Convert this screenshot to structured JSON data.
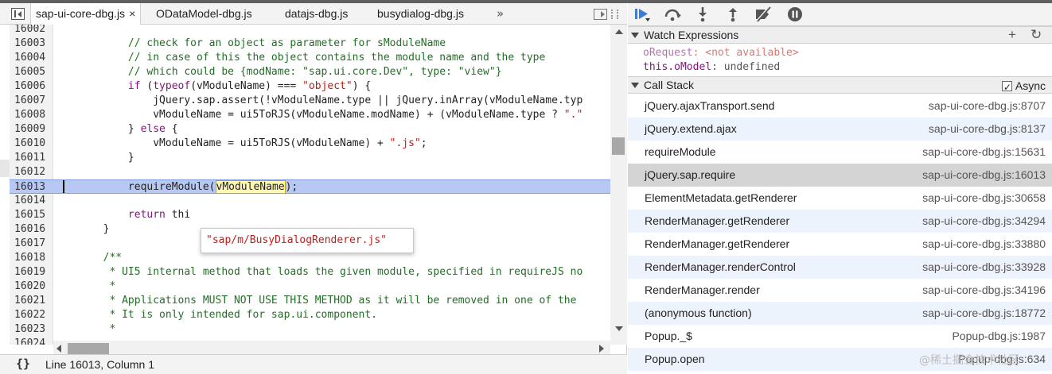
{
  "tabs": [
    {
      "label": "sap-ui-core-dbg.js",
      "active": true,
      "close": "×"
    },
    {
      "label": "ODataModel-dbg.js",
      "active": false
    },
    {
      "label": "datajs-dbg.js",
      "active": false
    },
    {
      "label": "busydialog-dbg.js",
      "active": false
    }
  ],
  "tab_overflow": "»",
  "code_lines": [
    {
      "num": "16002",
      "text": ""
    },
    {
      "num": "16003",
      "text": "            // check for an object as parameter for sModuleName"
    },
    {
      "num": "16004",
      "text": "            // in case of this the object contains the module name and the type"
    },
    {
      "num": "16005",
      "text": "            // which could be {modName: \"sap.ui.core.Dev\", type: \"view\"}"
    },
    {
      "num": "16006",
      "text": "            if (typeof(vModuleName) === \"object\") {"
    },
    {
      "num": "16007",
      "text": "                jQuery.sap.assert(!vModuleName.type || jQuery.inArray(vModuleName.typ"
    },
    {
      "num": "16008",
      "text": "                vModuleName = ui5ToRJS(vModuleName.modName) + (vModuleName.type ? \".\""
    },
    {
      "num": "16009",
      "text": "            } else {"
    },
    {
      "num": "16010",
      "text": "                vModuleName = ui5ToRJS(vModuleName) + \".js\";"
    },
    {
      "num": "16011",
      "text": "            }"
    },
    {
      "num": "16012",
      "text": ""
    },
    {
      "num": "16013",
      "text": "            requireModule(vModuleName);"
    },
    {
      "num": "16014",
      "text": ""
    },
    {
      "num": "16015",
      "text": "            return thi"
    },
    {
      "num": "16016",
      "text": "        }"
    },
    {
      "num": "16017",
      "text": ""
    },
    {
      "num": "16018",
      "text": "        /**"
    },
    {
      "num": "16019",
      "text": "         * UI5 internal method that loads the given module, specified in requireJS no"
    },
    {
      "num": "16020",
      "text": "         *"
    },
    {
      "num": "16021",
      "text": "         * Applications MUST NOT USE THIS METHOD as it will be removed in one of the"
    },
    {
      "num": "16022",
      "text": "         * It is only intended for sap.ui.component."
    },
    {
      "num": "16023",
      "text": "         *"
    },
    {
      "num": "16024",
      "text": ""
    }
  ],
  "popover": {
    "value": "\"sap/m/BusyDialogRenderer.js\""
  },
  "status": {
    "pretty_print": "{}",
    "position": "Line 16013, Column 1"
  },
  "watch": {
    "title": "Watch Expressions",
    "add": "+",
    "refresh": "↻",
    "items": [
      {
        "name": "oRequest",
        "sep": ": ",
        "value": "<not available>",
        "available": false
      },
      {
        "name": "this.oModel",
        "sep": ": ",
        "value": "undefined",
        "available": true
      }
    ]
  },
  "call_stack": {
    "title": "Call Stack",
    "async_label": "Async",
    "async_checked": true,
    "frames": [
      {
        "fn": "jQuery.ajaxTransport.send",
        "loc": "sap-ui-core-dbg.js:8707"
      },
      {
        "fn": "jQuery.extend.ajax",
        "loc": "sap-ui-core-dbg.js:8137"
      },
      {
        "fn": "requireModule",
        "loc": "sap-ui-core-dbg.js:15631"
      },
      {
        "fn": "jQuery.sap.require",
        "loc": "sap-ui-core-dbg.js:16013",
        "selected": true
      },
      {
        "fn": "ElementMetadata.getRenderer",
        "loc": "sap-ui-core-dbg.js:30658"
      },
      {
        "fn": "RenderManager.getRenderer",
        "loc": "sap-ui-core-dbg.js:34294"
      },
      {
        "fn": "RenderManager.getRenderer",
        "loc": "sap-ui-core-dbg.js:33880"
      },
      {
        "fn": "RenderManager.renderControl",
        "loc": "sap-ui-core-dbg.js:33928"
      },
      {
        "fn": "RenderManager.render",
        "loc": "sap-ui-core-dbg.js:34196"
      },
      {
        "fn": "(anonymous function)",
        "loc": "sap-ui-core-dbg.js:18772"
      },
      {
        "fn": "Popup._$",
        "loc": "Popup-dbg.js:1987"
      },
      {
        "fn": "Popup.open",
        "loc": "Popup-dbg.js:634"
      }
    ]
  },
  "watermark": "@稀土掘金技术社区",
  "colors": {
    "exec_line": "#b7c9f3",
    "selected_frame": "#d4d4d4",
    "alt_row": "#edf3fd",
    "comment": "#236e25",
    "keyword": "#881280",
    "string": "#c41a16",
    "resume_blue": "#3b7bd9"
  }
}
